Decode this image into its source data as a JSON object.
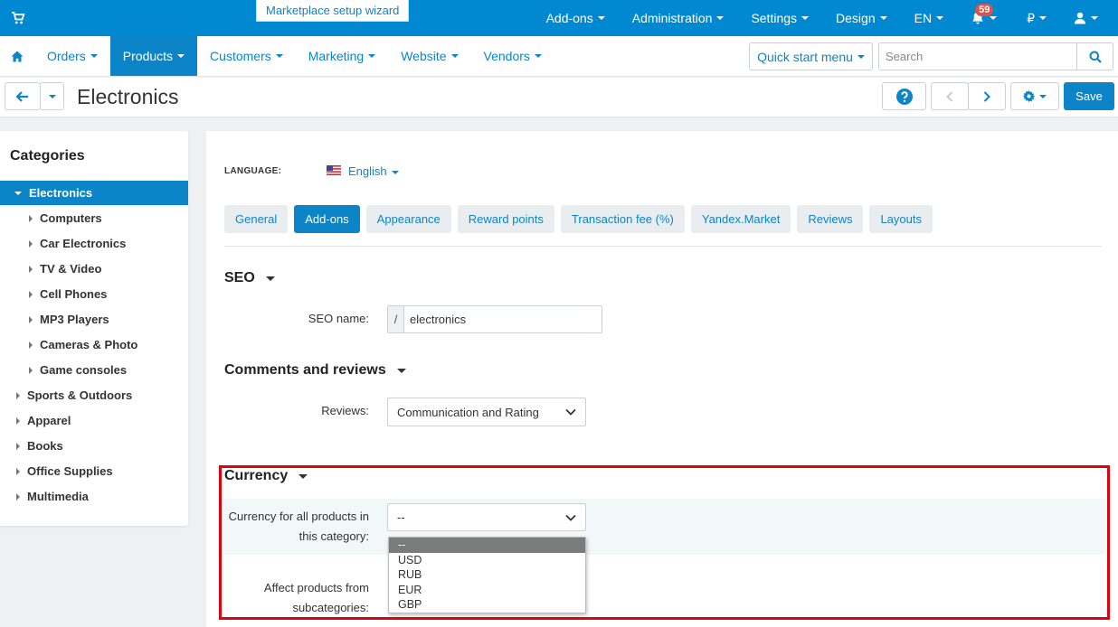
{
  "topbar": {
    "wizard_label": "Marketplace setup wizard",
    "menu": [
      {
        "label": "Add-ons"
      },
      {
        "label": "Administration"
      },
      {
        "label": "Settings"
      },
      {
        "label": "Design"
      },
      {
        "label": "EN"
      }
    ],
    "notifications_count": "59",
    "currency_symbol": "₽"
  },
  "nav": {
    "items": [
      {
        "label": "Orders"
      },
      {
        "label": "Products"
      },
      {
        "label": "Customers"
      },
      {
        "label": "Marketing"
      },
      {
        "label": "Website"
      },
      {
        "label": "Vendors"
      }
    ],
    "quick_start_label": "Quick start menu",
    "search_placeholder": "Search"
  },
  "titlebar": {
    "title": "Electronics",
    "save_label": "Save"
  },
  "sidebar": {
    "heading": "Categories",
    "items": [
      {
        "label": "Electronics"
      },
      {
        "label": "Computers"
      },
      {
        "label": "Car Electronics"
      },
      {
        "label": "TV & Video"
      },
      {
        "label": "Cell Phones"
      },
      {
        "label": "MP3 Players"
      },
      {
        "label": "Cameras & Photo"
      },
      {
        "label": "Game consoles"
      },
      {
        "label": "Sports & Outdoors"
      },
      {
        "label": "Apparel"
      },
      {
        "label": "Books"
      },
      {
        "label": "Office Supplies"
      },
      {
        "label": "Multimedia"
      }
    ]
  },
  "main": {
    "language_label": "LANGUAGE:",
    "language_value": "English",
    "tabs": [
      {
        "label": "General"
      },
      {
        "label": "Add-ons"
      },
      {
        "label": "Appearance"
      },
      {
        "label": "Reward points"
      },
      {
        "label": "Transaction fee (%)"
      },
      {
        "label": "Yandex.Market"
      },
      {
        "label": "Reviews"
      },
      {
        "label": "Layouts"
      }
    ],
    "seo": {
      "heading": "SEO",
      "name_label": "SEO name:",
      "prefix": "/",
      "name_value": "electronics"
    },
    "comments": {
      "heading": "Comments and reviews",
      "reviews_label": "Reviews:",
      "reviews_value": "Communication and Rating"
    },
    "currency": {
      "heading": "Currency",
      "all_products_label_1": "Currency for all products in",
      "all_products_label_2": "this category:",
      "selected_value": "--",
      "options": [
        "--",
        "USD",
        "RUB",
        "EUR",
        "GBP"
      ],
      "affect_label_1": "Affect products from",
      "affect_label_2": "subcategories:"
    }
  },
  "colors": {
    "brand": "#0089d1",
    "accent": "#0b85c8",
    "highlight_border": "#e3000b",
    "badge": "#d9534f"
  }
}
